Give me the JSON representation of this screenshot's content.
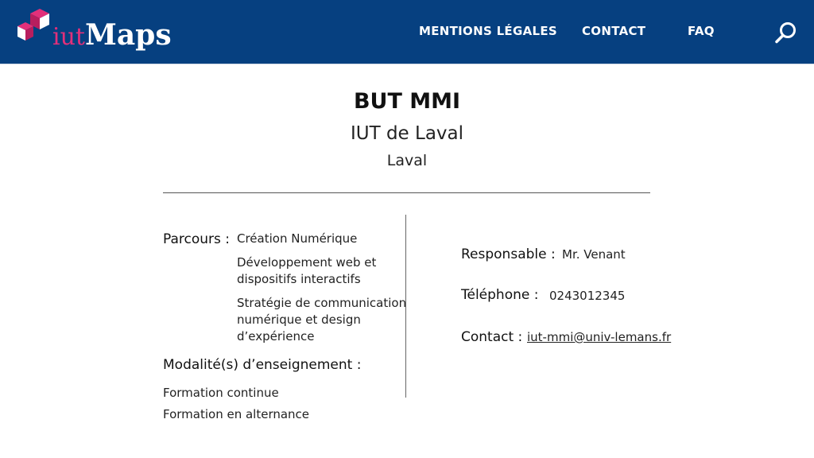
{
  "header": {
    "logo": {
      "prefix": "iut",
      "suffix": "Maps"
    },
    "nav": [
      "MENTIONS LÉGALES",
      "CONTACT",
      "FAQ"
    ],
    "search_icon": "search-icon",
    "colors": {
      "bar": "#064080",
      "accent": "#e2307a"
    }
  },
  "program": {
    "title": "BUT MMI",
    "institution": "IUT de Laval",
    "city": "Laval"
  },
  "details": {
    "parcours_label": "Parcours :",
    "parcours": [
      "Création Numérique",
      "Développement web et dispositifs interactifs",
      "Stratégie de communication numérique et design d’expérience"
    ],
    "modalites_label": "Modalité(s) d’enseignement :",
    "modalites": [
      "Formation continue",
      "Formation en alternance"
    ]
  },
  "contact": {
    "responsable_label": "Responsable :",
    "responsable": "Mr. Venant",
    "telephone_label": "Téléphone :",
    "telephone": "0243012345",
    "contact_label": "Contact :",
    "email": "iut-mmi@univ-lemans.fr"
  }
}
